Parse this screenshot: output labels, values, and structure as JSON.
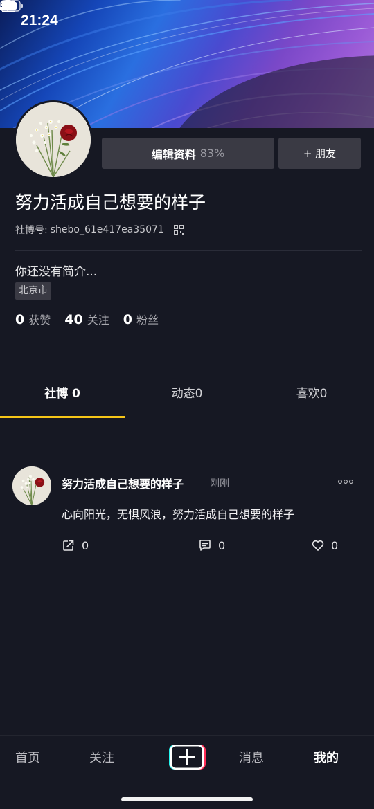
{
  "status_bar": {
    "time": "21:24"
  },
  "profile": {
    "edit_label": "编辑资料",
    "edit_percent": "83%",
    "add_friend_label": "+ 朋友",
    "username": "努力活成自己想要的样子",
    "id_label": "社博号:",
    "id_value": "shebo_61e417ea35071",
    "bio": "你还没有简介...",
    "location": "北京市",
    "stats": [
      {
        "value": "0",
        "label": "获赞"
      },
      {
        "value": "40",
        "label": "关注"
      },
      {
        "value": "0",
        "label": "粉丝"
      }
    ]
  },
  "tabs": [
    {
      "label": "社博 0"
    },
    {
      "label": "动态0"
    },
    {
      "label": "喜欢0"
    }
  ],
  "post": {
    "author": "努力活成自己想要的样子",
    "time": "刚刚",
    "text": "心向阳光，无惧风浪，努力活成自己想要的样子",
    "share_count": "0",
    "comment_count": "0",
    "like_count": "0"
  },
  "bottom_nav": [
    {
      "label": "首页"
    },
    {
      "label": "关注"
    },
    {
      "label": "消息"
    },
    {
      "label": "我的"
    }
  ],
  "colors": {
    "background": "#161823",
    "accent_underline": "#f5c518",
    "button_bg": "#3a3a44"
  }
}
